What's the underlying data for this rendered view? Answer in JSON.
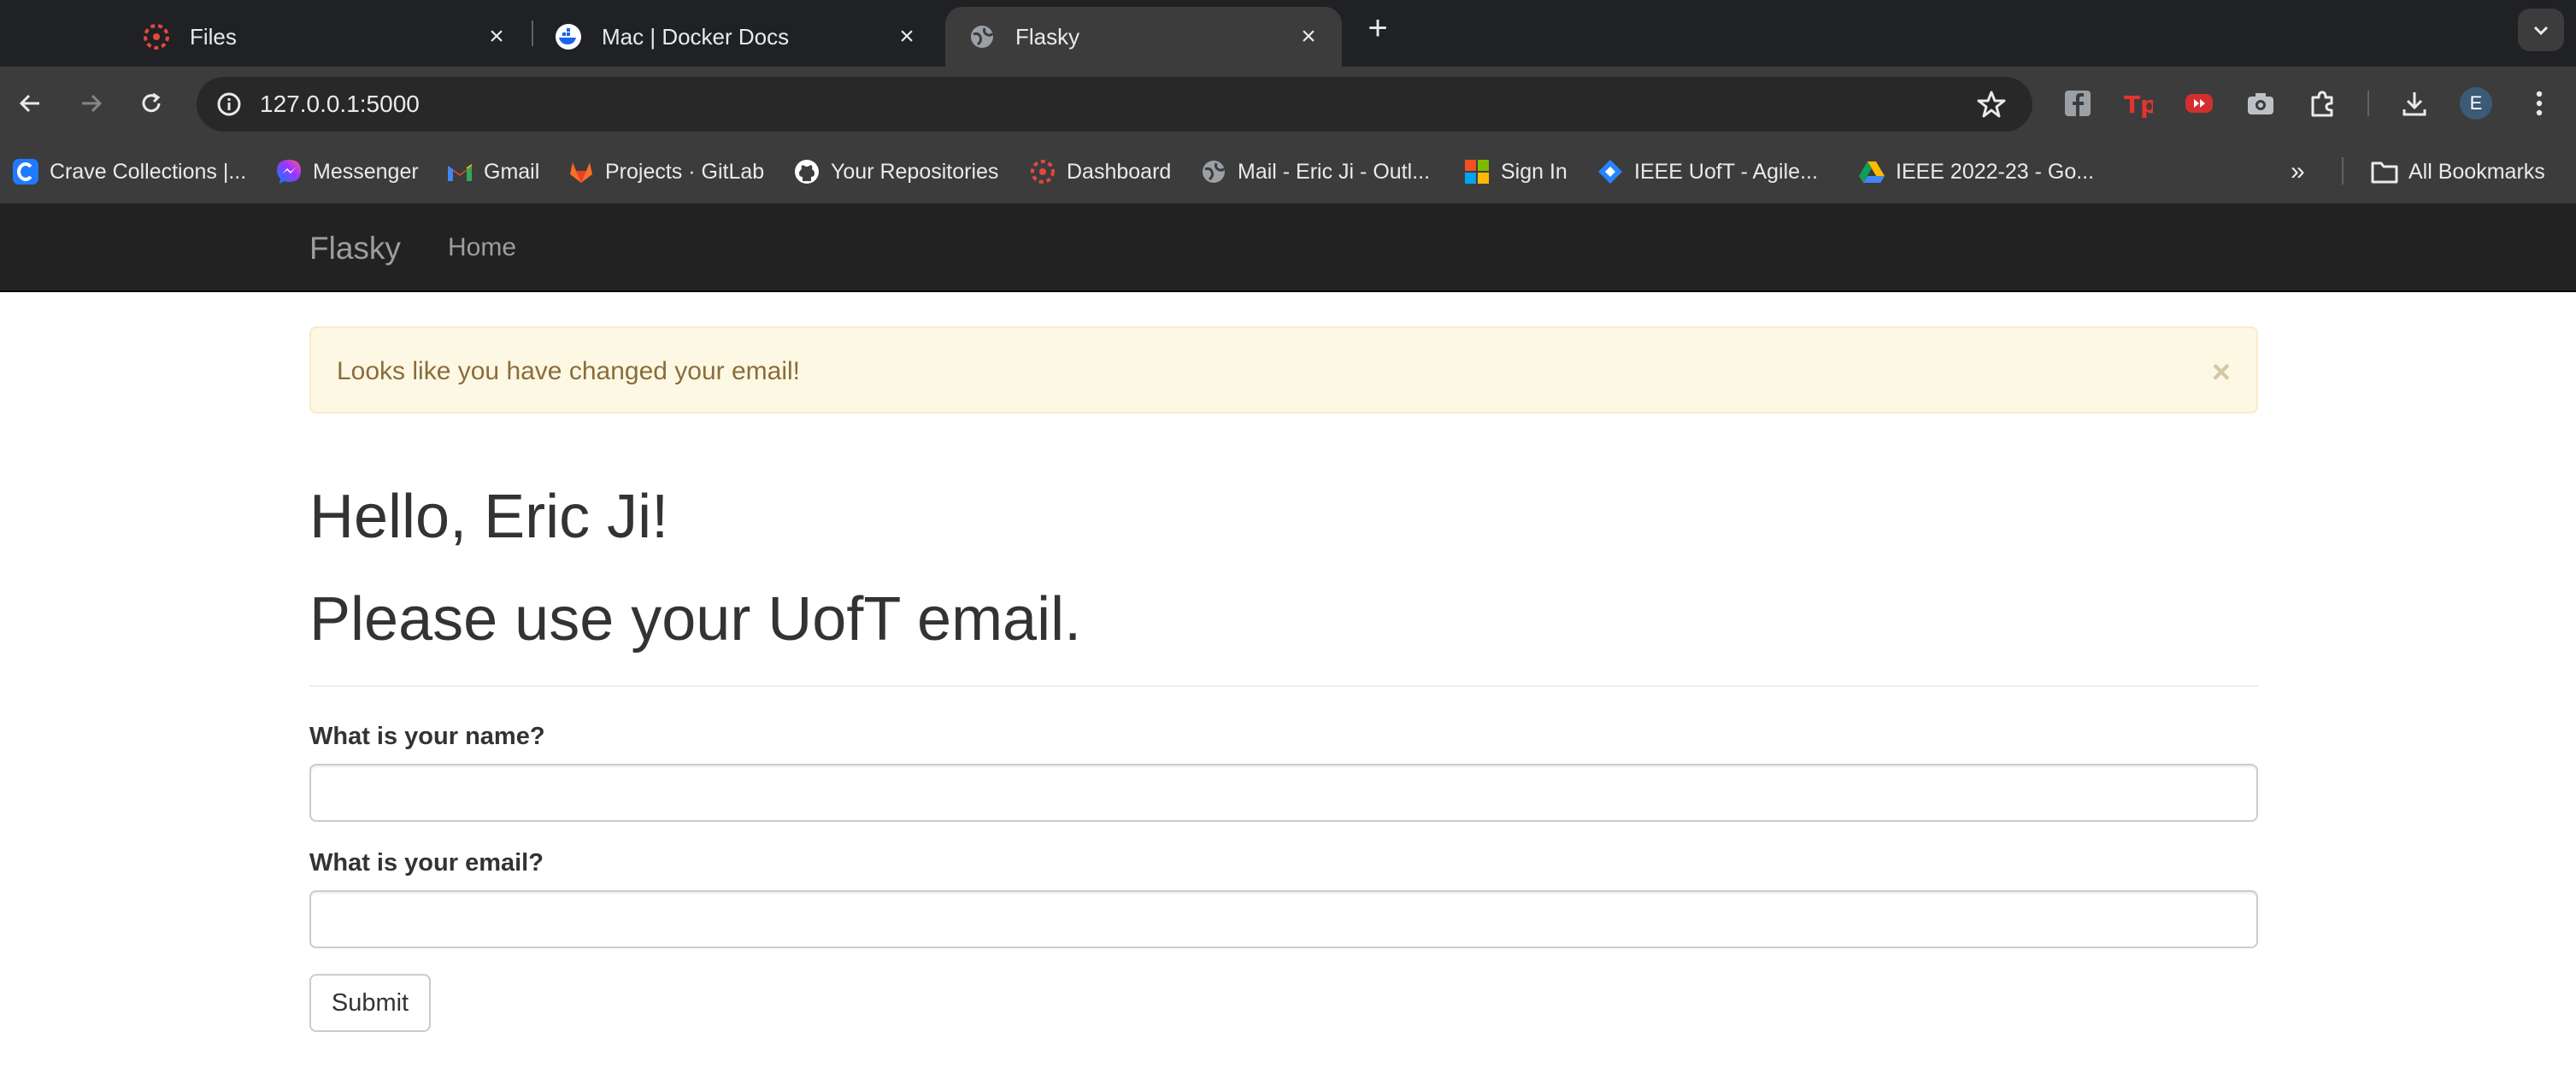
{
  "browser": {
    "tabs": [
      {
        "title": "Files",
        "icon": "canvas-icon"
      },
      {
        "title": "Mac | Docker Docs",
        "icon": "docker-icon"
      },
      {
        "title": "Flasky",
        "icon": "globe-icon",
        "active": true
      }
    ],
    "url": "127.0.0.1:5000",
    "profile_initial": "E",
    "bookmarks": [
      {
        "label": "Crave Collections |...",
        "icon": "crave-icon"
      },
      {
        "label": "Messenger",
        "icon": "messenger-icon"
      },
      {
        "label": "Gmail",
        "icon": "gmail-icon"
      },
      {
        "label": "Projects · GitLab",
        "icon": "gitlab-icon"
      },
      {
        "label": "Your Repositories",
        "icon": "github-icon"
      },
      {
        "label": "Dashboard",
        "icon": "canvas-icon"
      },
      {
        "label": "Mail - Eric Ji - Outl...",
        "icon": "globe-icon"
      },
      {
        "label": "Sign In",
        "icon": "microsoft-icon"
      },
      {
        "label": "IEEE UofT - Agile...",
        "icon": "jira-icon"
      },
      {
        "label": "IEEE 2022-23 - Go...",
        "icon": "drive-icon"
      }
    ],
    "all_bookmarks": "All Bookmarks",
    "more_bookmarks": "»"
  },
  "app": {
    "brand": "Flasky",
    "nav_home": "Home",
    "alert_message": "Looks like you have changed your email!",
    "alert_close": "×",
    "greeting": "Hello, Eric Ji!",
    "notice": "Please use your UofT email.",
    "form": {
      "name_label": "What is your name?",
      "name_value": "",
      "email_label": "What is your email?",
      "email_value": "",
      "submit_label": "Submit"
    }
  },
  "colors": {
    "chrome_dark": "#202124",
    "chrome_toolbar": "#3c3c3c",
    "app_navbar": "#222222",
    "alert_bg": "#fcf8e3",
    "alert_text": "#8a6d3b"
  }
}
